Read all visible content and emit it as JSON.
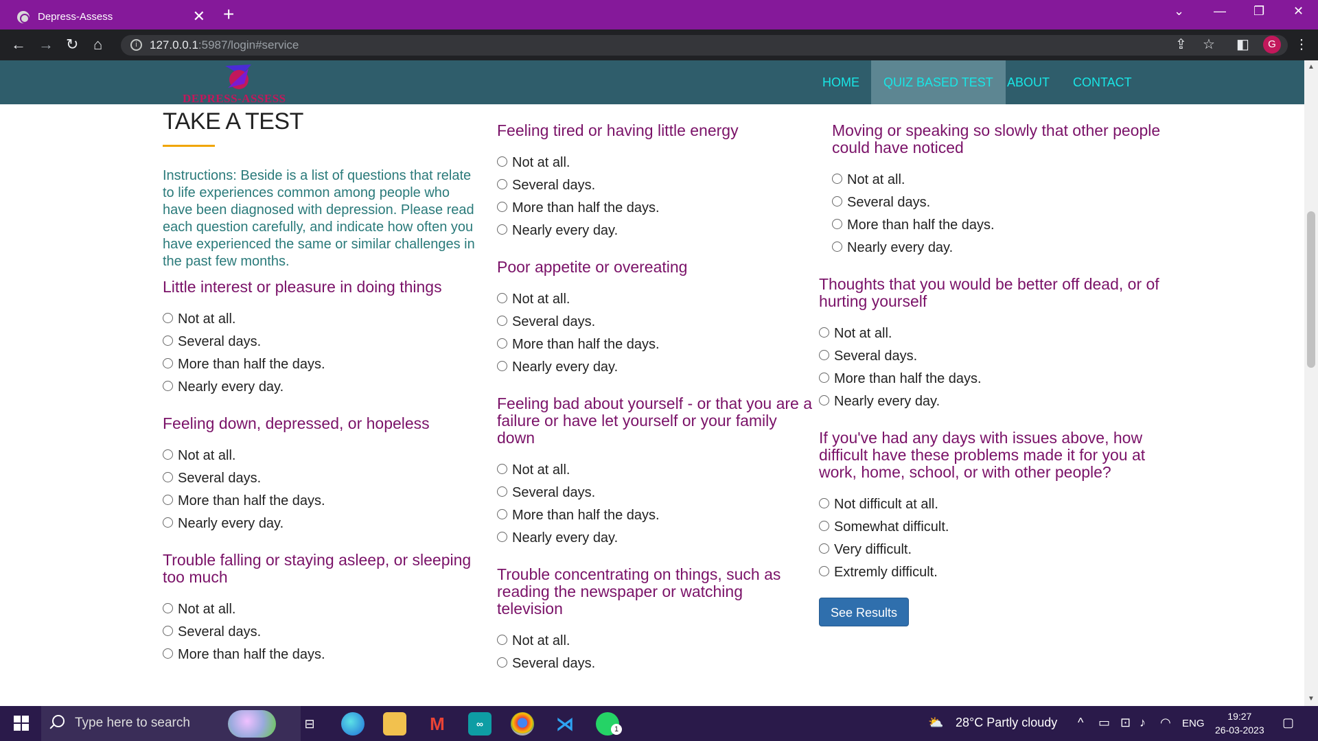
{
  "browser": {
    "tab_title": "Depress-Assess",
    "tab_close": "✕",
    "new_tab": "+",
    "url_host": "127.0.0.1",
    "url_path": ":5987/login#service",
    "profile_initial": "G"
  },
  "site": {
    "logo_text": "DEPRESS-ASSESS",
    "nav": [
      "HOME",
      "QUIZ BASED TEST",
      "ABOUT",
      "CONTACT"
    ],
    "active_nav": "QUIZ BASED TEST"
  },
  "page": {
    "title": "TAKE A TEST",
    "instructions": "Instructions: Beside is a list of questions that relate to life experiences common among people who have been diagnosed with depression. Please read each question carefully, and indicate how often you have experienced the same or similar challenges in the past few months.",
    "options": [
      "Not at all.",
      "Several days.",
      "More than half the days.",
      "Nearly every day."
    ],
    "difficulty_options": [
      "Not difficult at all.",
      "Somewhat difficult.",
      "Very difficult.",
      "Extremly difficult."
    ],
    "questions": [
      "Little interest or pleasure in doing things",
      "Feeling down, depressed, or hopeless",
      "Trouble falling or staying asleep, or sleeping too much",
      "Feeling tired or having little energy",
      "Poor appetite or overeating",
      "Feeling bad about yourself - or that you are a failure or have let yourself or your family down",
      "Trouble concentrating on things, such as reading the newspaper or watching television",
      "Moving or speaking so slowly that other people could have noticed",
      "Thoughts that you would be better off dead, or of hurting yourself",
      "If you've had any days with issues above, how difficult have these problems made it for you at work, home, school, or with other people?"
    ],
    "results_button": "See Results"
  },
  "taskbar": {
    "search_placeholder": "Type here to search",
    "weather": "28°C  Partly cloudy",
    "language": "ENG",
    "time": "19:27",
    "date": "26-03-2023",
    "whatsapp_badge": "1"
  }
}
